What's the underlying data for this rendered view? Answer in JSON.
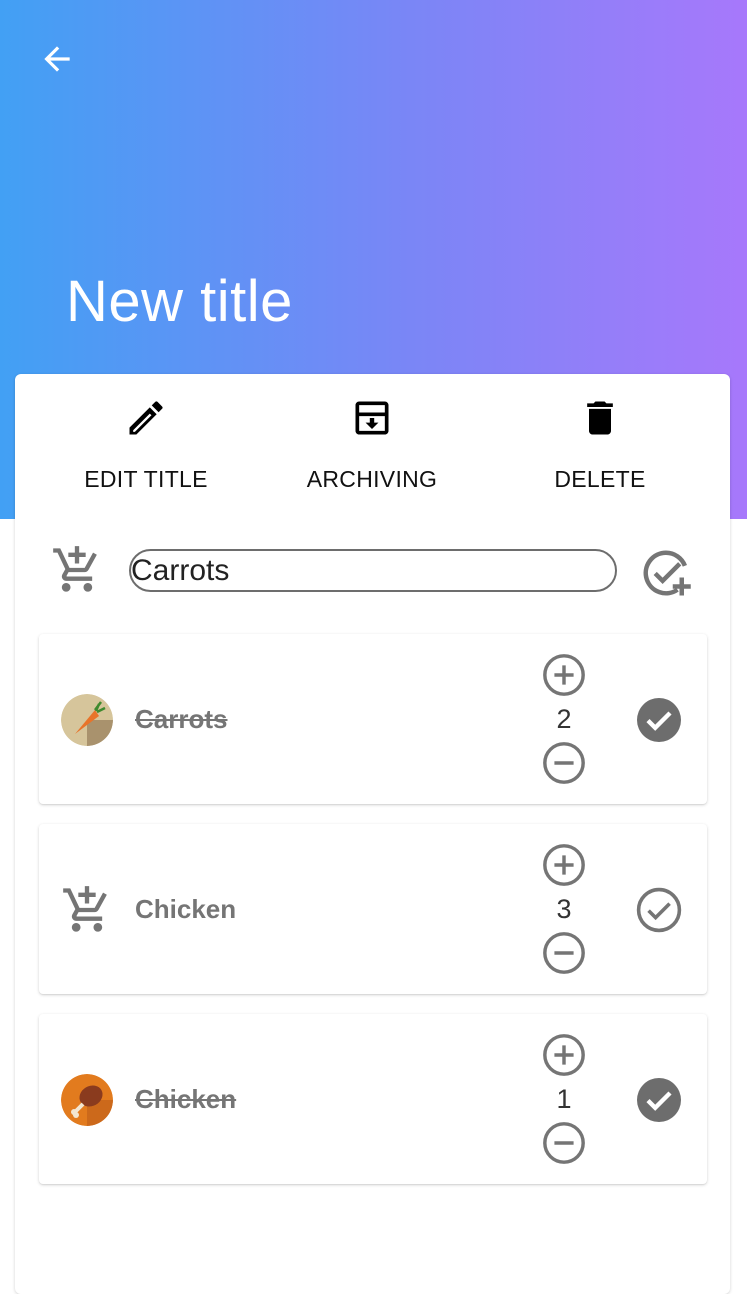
{
  "app": {
    "title": "New title",
    "back_icon": "arrow-back-icon",
    "gradient": [
      "#42a0f4",
      "#a778fb"
    ]
  },
  "actions": [
    {
      "label": "EDIT TITLE",
      "icon": "pencil-icon"
    },
    {
      "label": "ARCHIVING",
      "icon": "archive-icon"
    },
    {
      "label": "DELETE",
      "icon": "trash-icon"
    }
  ],
  "add_item": {
    "value": "Carrots",
    "add_icon": "add-cart-icon",
    "confirm_icon": "check-add-icon"
  },
  "items": [
    {
      "name": "Carrots",
      "quantity": "2",
      "checked": true,
      "thumb": "carrot-image"
    },
    {
      "name": "Chicken",
      "quantity": "3",
      "checked": false,
      "thumb": "add-cart-icon"
    },
    {
      "name": "Chicken",
      "quantity": "1",
      "checked": true,
      "thumb": "chicken-image"
    }
  ],
  "colors": {
    "icon_gray": "#757575",
    "check_filled": "#6d6d6d"
  }
}
